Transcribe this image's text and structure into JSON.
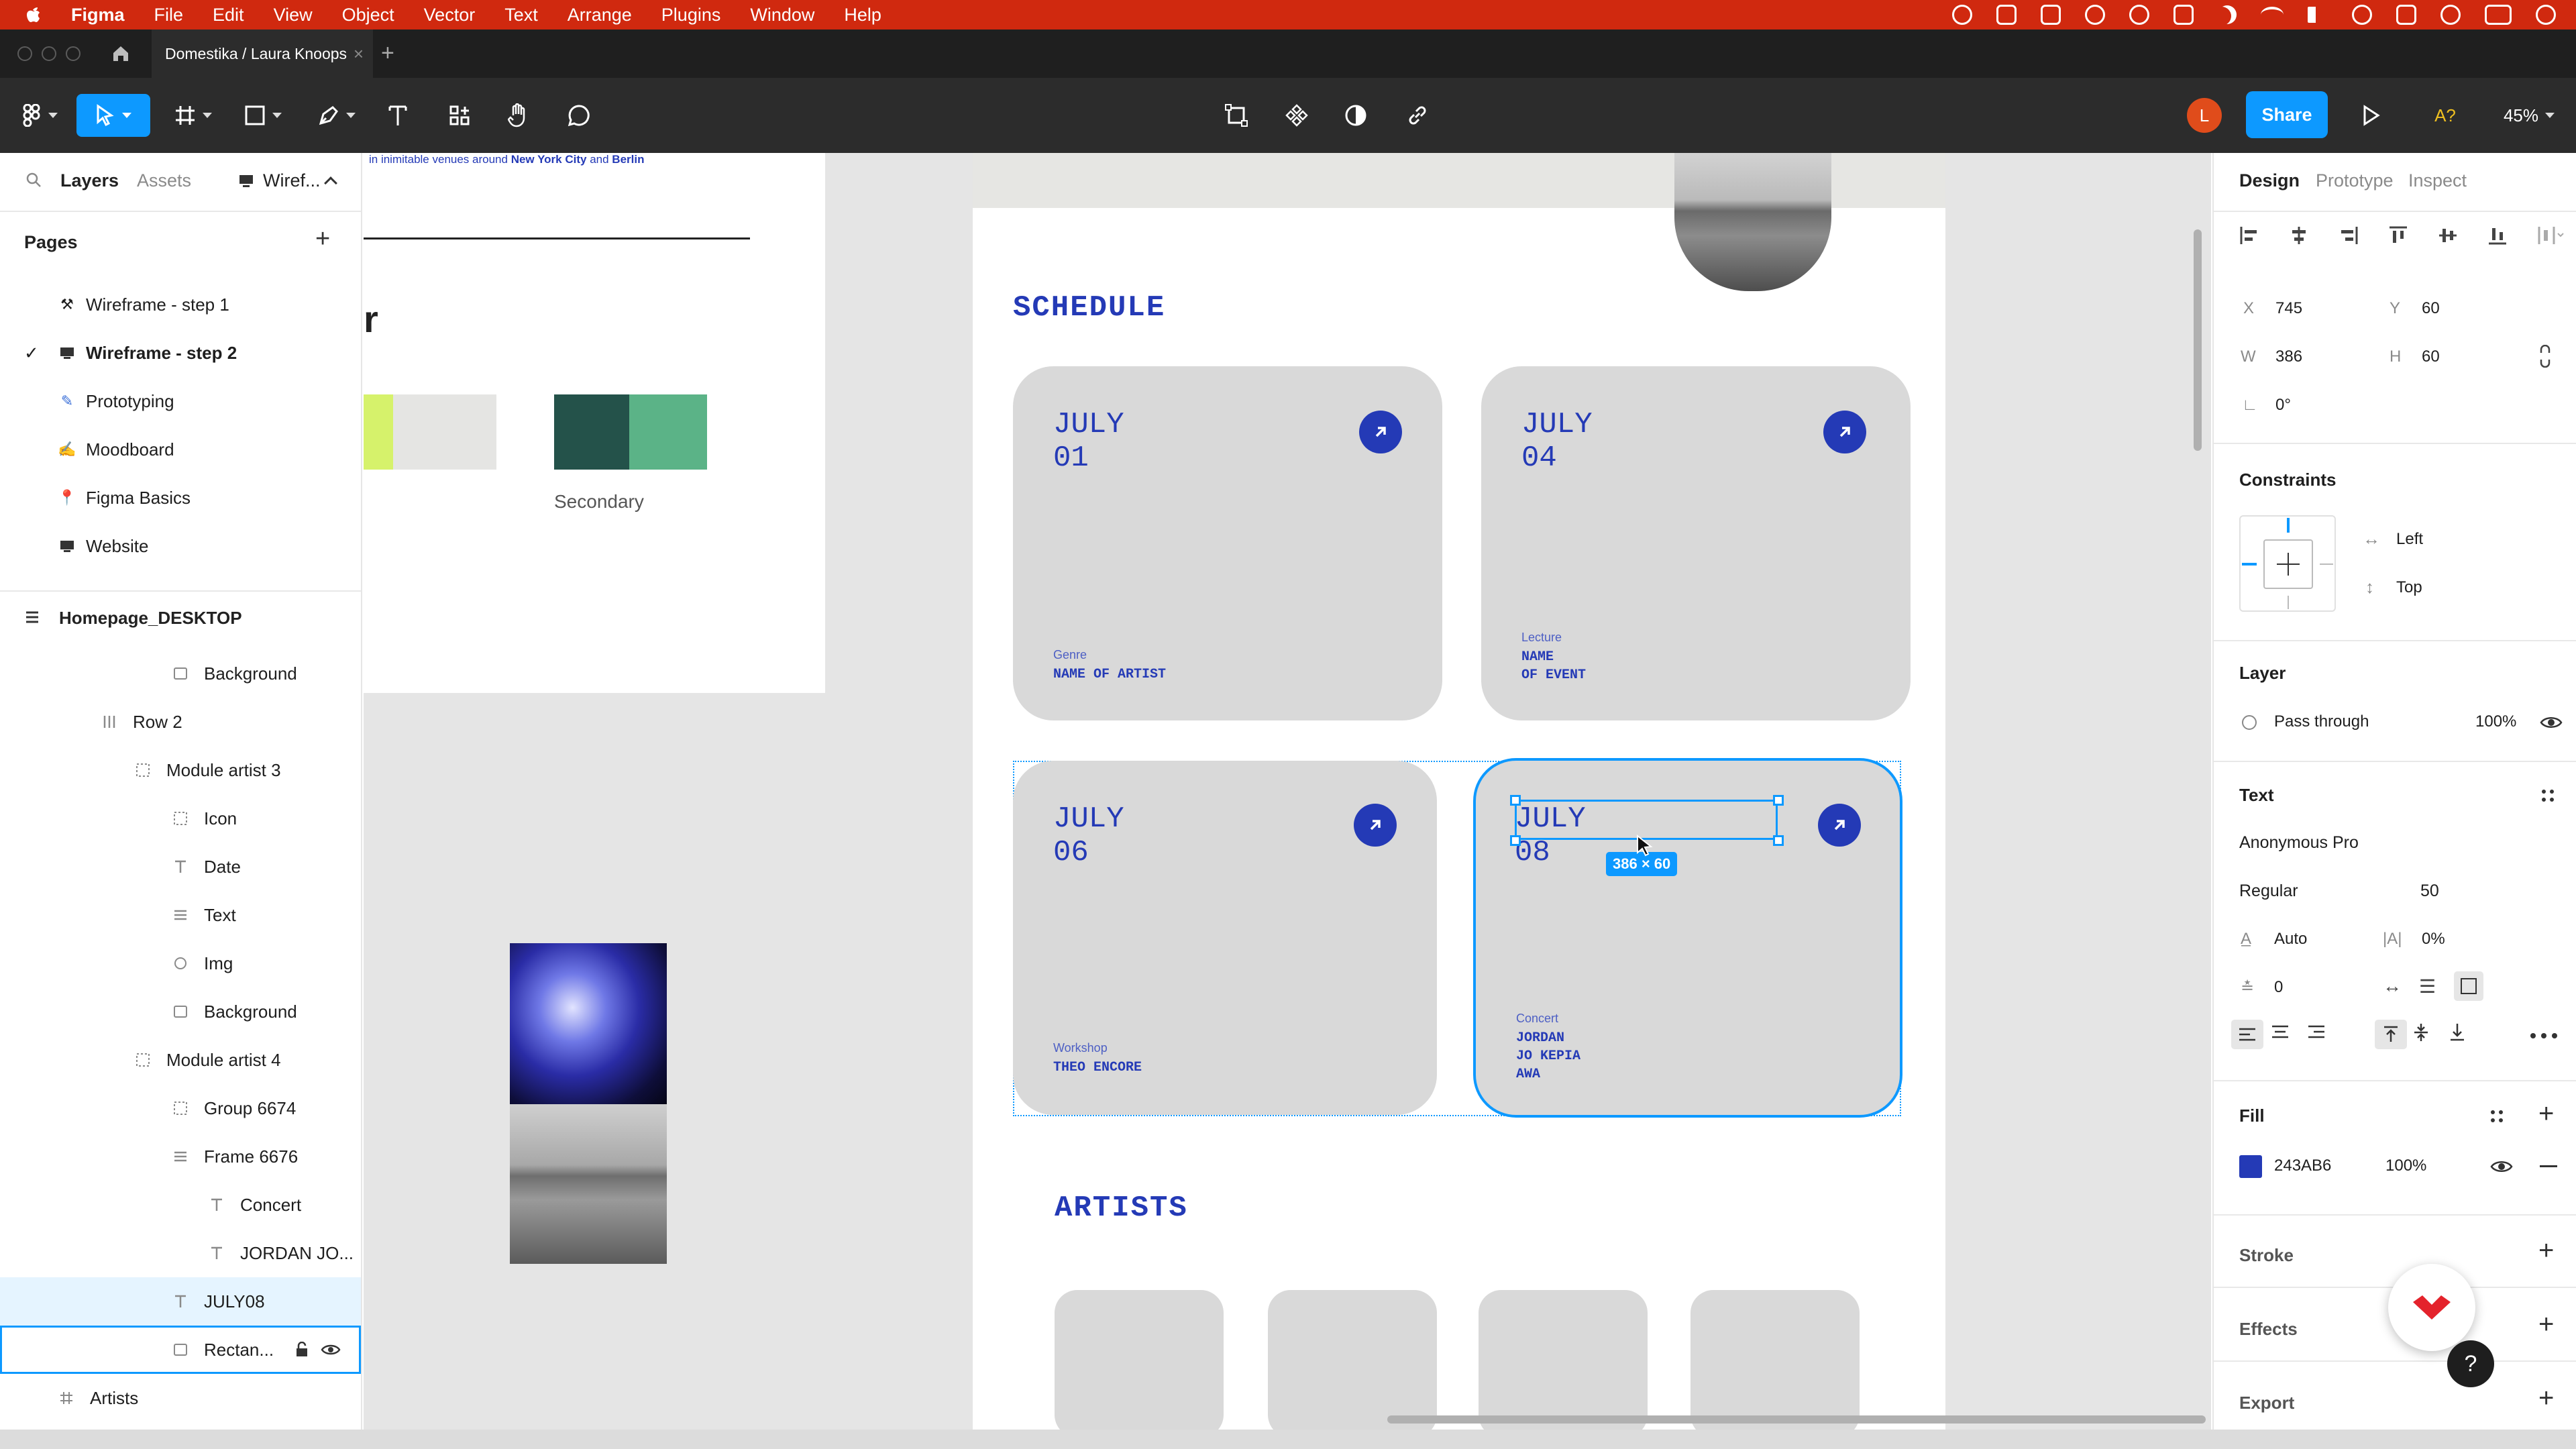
{
  "menubar": {
    "app_name": "Figma",
    "items": [
      "File",
      "Edit",
      "View",
      "Object",
      "Vector",
      "Text",
      "Arrange",
      "Plugins",
      "Window",
      "Help"
    ]
  },
  "tabs": {
    "active": "Domestika / Laura Knoops"
  },
  "toolbar": {
    "share_label": "Share",
    "avatar_initial": "L",
    "ai_label": "A?",
    "zoom": "45%"
  },
  "left_panel": {
    "tab_layers": "Layers",
    "tab_assets": "Assets",
    "file_menu": "Wiref...",
    "pages_title": "Pages",
    "pages": [
      {
        "icon": "hammer",
        "label": "Wireframe - step 1",
        "checked": false
      },
      {
        "icon": "monitor",
        "label": "Wireframe - step 2",
        "checked": true
      },
      {
        "icon": "pencil",
        "label": "Prototyping",
        "checked": false
      },
      {
        "icon": "pencil",
        "label": "Moodboard",
        "checked": false
      },
      {
        "icon": "pin",
        "label": "Figma Basics",
        "checked": false
      },
      {
        "icon": "monitor",
        "label": "Website",
        "checked": false
      }
    ],
    "frame_name": "Homepage_DESKTOP",
    "layers": [
      {
        "label": "Background",
        "icon": "rect",
        "indent": 3
      },
      {
        "label": "Row 2",
        "icon": "columns",
        "indent": 1
      },
      {
        "label": "Module artist 3",
        "icon": "frame-dotted",
        "indent": 2
      },
      {
        "label": "Icon",
        "icon": "frame-dotted",
        "indent": 3
      },
      {
        "label": "Date",
        "icon": "text",
        "indent": 3
      },
      {
        "label": "Text",
        "icon": "stack",
        "indent": 3
      },
      {
        "label": "Img",
        "icon": "ellipse",
        "indent": 3
      },
      {
        "label": "Background",
        "icon": "rect",
        "indent": 3
      },
      {
        "label": "Module artist 4",
        "icon": "frame-dotted",
        "indent": 2
      },
      {
        "label": "Group 6674",
        "icon": "frame-dotted",
        "indent": 3
      },
      {
        "label": "Frame 6676",
        "icon": "stack",
        "indent": 3
      },
      {
        "label": "Concert",
        "icon": "text",
        "indent": 4
      },
      {
        "label": "JORDAN JO...",
        "icon": "text",
        "indent": 4
      },
      {
        "label": "JULY08",
        "icon": "text",
        "indent": 3
      },
      {
        "label": "Rectan...",
        "icon": "rect",
        "indent": 3
      },
      {
        "label": "Artists",
        "icon": "hash",
        "indent": 0
      },
      {
        "label": "ARTISTS",
        "icon": "text",
        "indent": 1
      }
    ]
  },
  "canvas": {
    "left_frame": {
      "snippet_text": "in inimitable venues around",
      "snippet_city1": "New York City",
      "snippet_and": "and",
      "snippet_city2": "Berlin",
      "heading_fragment": "r",
      "secondary_label": "Secondary",
      "colors": {
        "primary_a": "#d6f26b",
        "primary_b": "#e5e5e3",
        "secondary_a": "#24524a",
        "secondary_b": "#5bb387"
      }
    },
    "schedule_title": "SCHEDULE",
    "cards": [
      {
        "date": "JULY\n01",
        "category": "Genre",
        "name": "NAME OF ARTIST"
      },
      {
        "date": "JULY\n04",
        "category": "Lecture",
        "name": "NAME\nOF EVENT"
      },
      {
        "date": "JULY\n06",
        "category": "Workshop",
        "name": "THEO ENCORE"
      },
      {
        "date": "JULY\n08",
        "category": "Concert",
        "name": "JORDAN\nJO KEPIA\nAWA"
      }
    ],
    "selection_size": "386 × 60",
    "artists_title": "ARTISTS",
    "accent": "#243ab6",
    "selection_color": "#0d99ff"
  },
  "right_panel": {
    "tabs": [
      "Design",
      "Prototype",
      "Inspect"
    ],
    "x": "745",
    "y": "60",
    "w": "386",
    "h": "60",
    "rotation": "0°",
    "constraints_title": "Constraints",
    "constraint_h": "Left",
    "constraint_v": "Top",
    "layer_title": "Layer",
    "blend_mode": "Pass through",
    "layer_opacity": "100%",
    "text_title": "Text",
    "font_family": "Anonymous Pro",
    "font_weight": "Regular",
    "font_size": "50",
    "line_height": "Auto",
    "letter_spacing": "0%",
    "paragraph_spacing": "0",
    "fill_title": "Fill",
    "fill_hex": "243AB6",
    "fill_opacity": "100%",
    "stroke_title": "Stroke",
    "effects_title": "Effects",
    "export_title": "Export",
    "help": "?"
  }
}
